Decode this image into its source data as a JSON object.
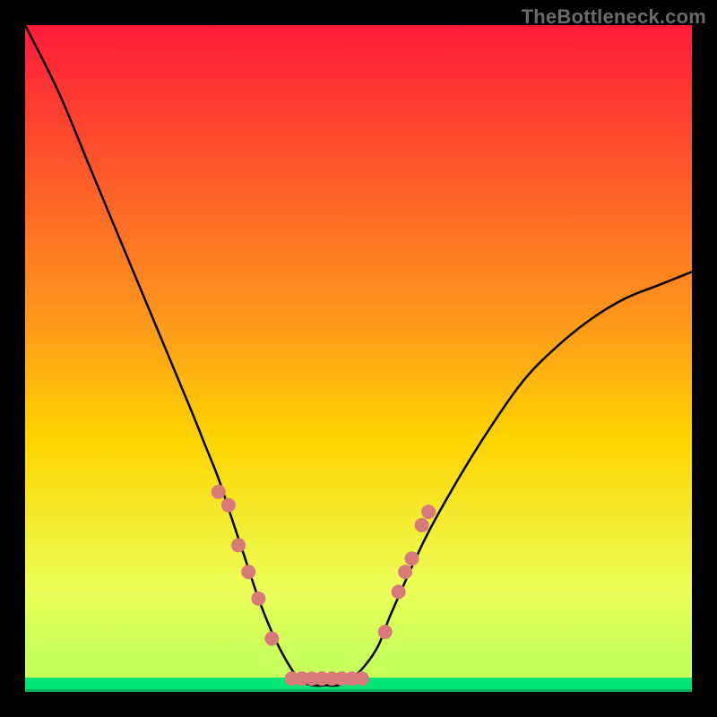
{
  "watermark": "TheBottleneck.com",
  "chart_data": {
    "type": "line",
    "title": "",
    "xlabel": "",
    "ylabel": "",
    "xlim": [
      0,
      100
    ],
    "ylim": [
      0,
      100
    ],
    "grid": false,
    "legend": false,
    "series": [
      {
        "name": "curve",
        "x": [
          0,
          5,
          10,
          15,
          20,
          25,
          27,
          29,
          31,
          33,
          35,
          37,
          39,
          41,
          43,
          45,
          47,
          49,
          51,
          53,
          55,
          60,
          65,
          70,
          75,
          80,
          85,
          90,
          95,
          100
        ],
        "values": [
          100,
          90,
          78,
          66,
          54,
          42,
          37,
          32,
          26,
          20,
          14,
          9,
          5,
          2,
          1,
          1,
          1,
          2,
          4,
          7,
          12,
          23,
          32,
          40,
          47,
          52,
          56,
          59,
          61,
          63
        ]
      }
    ],
    "markers": {
      "name": "dots",
      "points": [
        {
          "x": 29.0,
          "y": 30
        },
        {
          "x": 30.5,
          "y": 28
        },
        {
          "x": 32.0,
          "y": 22
        },
        {
          "x": 33.5,
          "y": 18
        },
        {
          "x": 35.0,
          "y": 14
        },
        {
          "x": 37.0,
          "y": 8
        },
        {
          "x": 40.0,
          "y": 2
        },
        {
          "x": 41.5,
          "y": 2
        },
        {
          "x": 43.0,
          "y": 2
        },
        {
          "x": 44.5,
          "y": 2
        },
        {
          "x": 46.0,
          "y": 2
        },
        {
          "x": 47.5,
          "y": 2
        },
        {
          "x": 49.0,
          "y": 2
        },
        {
          "x": 50.5,
          "y": 2
        },
        {
          "x": 54.0,
          "y": 9
        },
        {
          "x": 56.0,
          "y": 15
        },
        {
          "x": 57.0,
          "y": 18
        },
        {
          "x": 58.0,
          "y": 20
        },
        {
          "x": 59.5,
          "y": 25
        },
        {
          "x": 60.5,
          "y": 27
        }
      ]
    },
    "background_gradient": {
      "top": "#ff1a3a",
      "middle": "#ffd400",
      "bottom": "#eaff57",
      "base": "#00e676"
    },
    "marker_color": "#d97a7a",
    "curve_color": "#000000"
  }
}
